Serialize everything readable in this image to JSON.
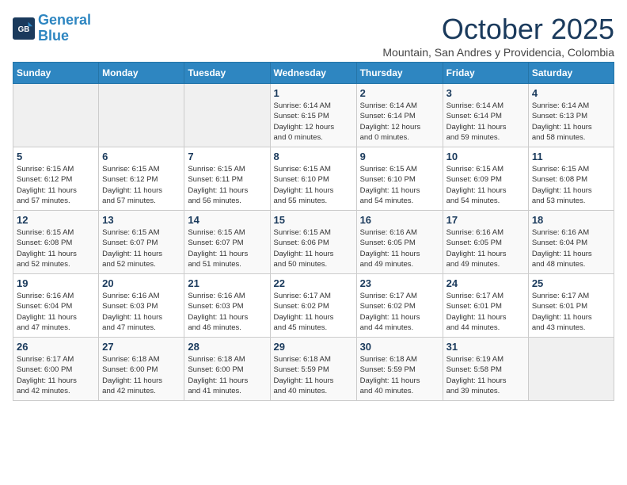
{
  "header": {
    "logo_line1": "General",
    "logo_line2": "Blue",
    "title": "October 2025",
    "location": "Mountain, San Andres y Providencia, Colombia"
  },
  "days_of_week": [
    "Sunday",
    "Monday",
    "Tuesday",
    "Wednesday",
    "Thursday",
    "Friday",
    "Saturday"
  ],
  "weeks": [
    [
      {
        "day": "",
        "info": ""
      },
      {
        "day": "",
        "info": ""
      },
      {
        "day": "",
        "info": ""
      },
      {
        "day": "1",
        "info": "Sunrise: 6:14 AM\nSunset: 6:15 PM\nDaylight: 12 hours\nand 0 minutes."
      },
      {
        "day": "2",
        "info": "Sunrise: 6:14 AM\nSunset: 6:14 PM\nDaylight: 12 hours\nand 0 minutes."
      },
      {
        "day": "3",
        "info": "Sunrise: 6:14 AM\nSunset: 6:14 PM\nDaylight: 11 hours\nand 59 minutes."
      },
      {
        "day": "4",
        "info": "Sunrise: 6:14 AM\nSunset: 6:13 PM\nDaylight: 11 hours\nand 58 minutes."
      }
    ],
    [
      {
        "day": "5",
        "info": "Sunrise: 6:15 AM\nSunset: 6:12 PM\nDaylight: 11 hours\nand 57 minutes."
      },
      {
        "day": "6",
        "info": "Sunrise: 6:15 AM\nSunset: 6:12 PM\nDaylight: 11 hours\nand 57 minutes."
      },
      {
        "day": "7",
        "info": "Sunrise: 6:15 AM\nSunset: 6:11 PM\nDaylight: 11 hours\nand 56 minutes."
      },
      {
        "day": "8",
        "info": "Sunrise: 6:15 AM\nSunset: 6:10 PM\nDaylight: 11 hours\nand 55 minutes."
      },
      {
        "day": "9",
        "info": "Sunrise: 6:15 AM\nSunset: 6:10 PM\nDaylight: 11 hours\nand 54 minutes."
      },
      {
        "day": "10",
        "info": "Sunrise: 6:15 AM\nSunset: 6:09 PM\nDaylight: 11 hours\nand 54 minutes."
      },
      {
        "day": "11",
        "info": "Sunrise: 6:15 AM\nSunset: 6:08 PM\nDaylight: 11 hours\nand 53 minutes."
      }
    ],
    [
      {
        "day": "12",
        "info": "Sunrise: 6:15 AM\nSunset: 6:08 PM\nDaylight: 11 hours\nand 52 minutes."
      },
      {
        "day": "13",
        "info": "Sunrise: 6:15 AM\nSunset: 6:07 PM\nDaylight: 11 hours\nand 52 minutes."
      },
      {
        "day": "14",
        "info": "Sunrise: 6:15 AM\nSunset: 6:07 PM\nDaylight: 11 hours\nand 51 minutes."
      },
      {
        "day": "15",
        "info": "Sunrise: 6:15 AM\nSunset: 6:06 PM\nDaylight: 11 hours\nand 50 minutes."
      },
      {
        "day": "16",
        "info": "Sunrise: 6:16 AM\nSunset: 6:05 PM\nDaylight: 11 hours\nand 49 minutes."
      },
      {
        "day": "17",
        "info": "Sunrise: 6:16 AM\nSunset: 6:05 PM\nDaylight: 11 hours\nand 49 minutes."
      },
      {
        "day": "18",
        "info": "Sunrise: 6:16 AM\nSunset: 6:04 PM\nDaylight: 11 hours\nand 48 minutes."
      }
    ],
    [
      {
        "day": "19",
        "info": "Sunrise: 6:16 AM\nSunset: 6:04 PM\nDaylight: 11 hours\nand 47 minutes."
      },
      {
        "day": "20",
        "info": "Sunrise: 6:16 AM\nSunset: 6:03 PM\nDaylight: 11 hours\nand 47 minutes."
      },
      {
        "day": "21",
        "info": "Sunrise: 6:16 AM\nSunset: 6:03 PM\nDaylight: 11 hours\nand 46 minutes."
      },
      {
        "day": "22",
        "info": "Sunrise: 6:17 AM\nSunset: 6:02 PM\nDaylight: 11 hours\nand 45 minutes."
      },
      {
        "day": "23",
        "info": "Sunrise: 6:17 AM\nSunset: 6:02 PM\nDaylight: 11 hours\nand 44 minutes."
      },
      {
        "day": "24",
        "info": "Sunrise: 6:17 AM\nSunset: 6:01 PM\nDaylight: 11 hours\nand 44 minutes."
      },
      {
        "day": "25",
        "info": "Sunrise: 6:17 AM\nSunset: 6:01 PM\nDaylight: 11 hours\nand 43 minutes."
      }
    ],
    [
      {
        "day": "26",
        "info": "Sunrise: 6:17 AM\nSunset: 6:00 PM\nDaylight: 11 hours\nand 42 minutes."
      },
      {
        "day": "27",
        "info": "Sunrise: 6:18 AM\nSunset: 6:00 PM\nDaylight: 11 hours\nand 42 minutes."
      },
      {
        "day": "28",
        "info": "Sunrise: 6:18 AM\nSunset: 6:00 PM\nDaylight: 11 hours\nand 41 minutes."
      },
      {
        "day": "29",
        "info": "Sunrise: 6:18 AM\nSunset: 5:59 PM\nDaylight: 11 hours\nand 40 minutes."
      },
      {
        "day": "30",
        "info": "Sunrise: 6:18 AM\nSunset: 5:59 PM\nDaylight: 11 hours\nand 40 minutes."
      },
      {
        "day": "31",
        "info": "Sunrise: 6:19 AM\nSunset: 5:58 PM\nDaylight: 11 hours\nand 39 minutes."
      },
      {
        "day": "",
        "info": ""
      }
    ]
  ]
}
